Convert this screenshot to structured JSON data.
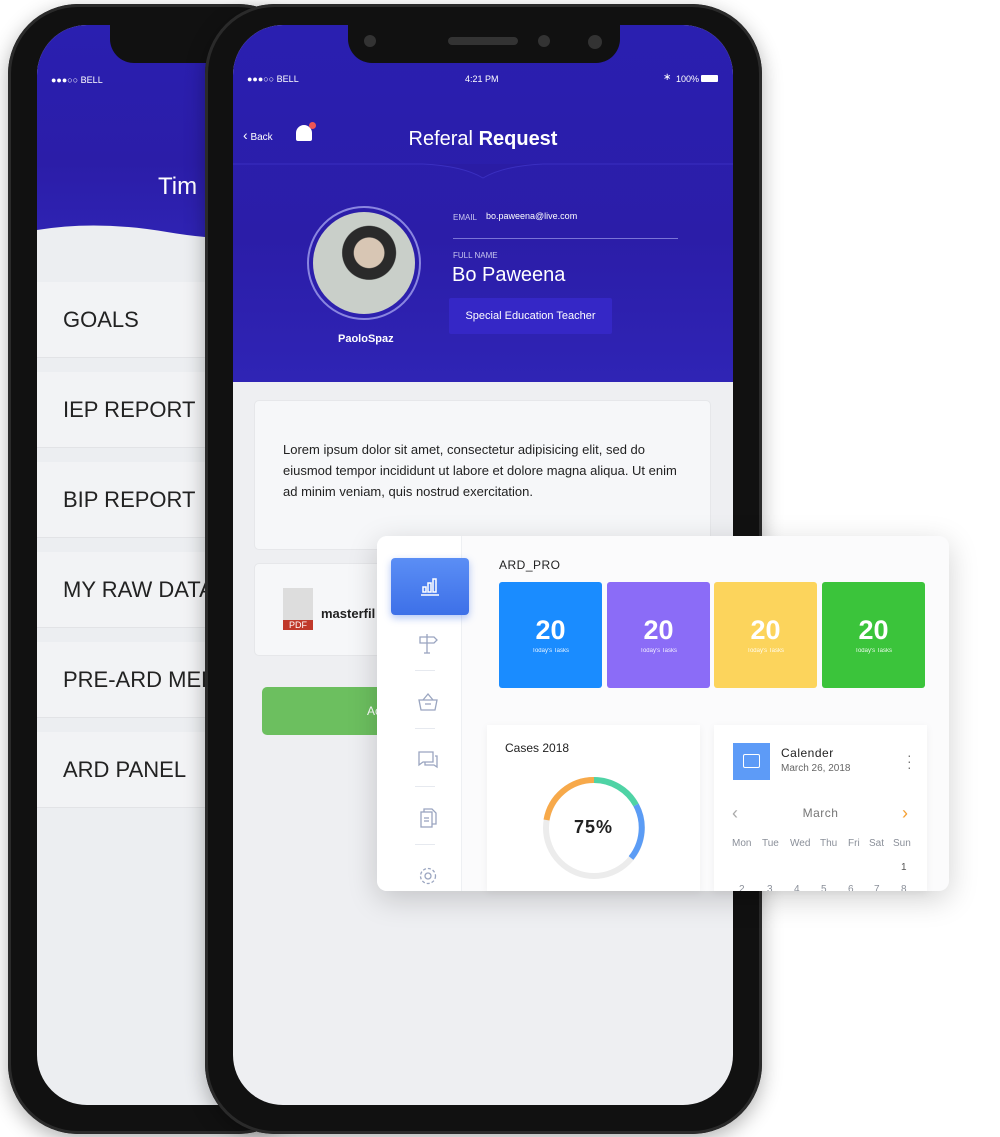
{
  "left_phone": {
    "status": {
      "carrier": "●●●○○ BELL"
    },
    "title": "Tim",
    "menu": [
      "GOALS",
      "IEP REPORT",
      "BIP REPORT",
      "MY RAW DATA",
      "PRE-ARD MEE",
      "ARD PANEL"
    ]
  },
  "main_phone": {
    "status": {
      "carrier": "●●●○○ BELL",
      "time": "4:21 PM",
      "battery": "100%"
    },
    "header": {
      "back": "Back",
      "title_light": "Referal",
      "title_bold": "Request"
    },
    "profile": {
      "username": "PaoloSpaz",
      "email_label": "EMAIL",
      "email": "bo.paweena@live.com",
      "name_label": "FULL NAME",
      "name": "Bo Paweena",
      "role": "Special Education Teacher"
    },
    "description": "Lorem ipsum dolor sit amet, consectetur adipisicing elit, sed do eiusmod tempor incididunt ut labore et dolore magna aliqua. Ut enim ad minim veniam, quis nostrud exercitation.",
    "attachment": {
      "icon_label": "PDF",
      "filename": "masterfil"
    },
    "button": "Ac"
  },
  "dashboard": {
    "title": "ARD_PRO",
    "tiles": [
      {
        "value": "20",
        "label": "Today's Tasks",
        "color": "#1a8cff"
      },
      {
        "value": "20",
        "label": "Today's Tasks",
        "color": "#8b6cf7"
      },
      {
        "value": "20",
        "label": "Today's Tasks",
        "color": "#fcd45c"
      },
      {
        "value": "20",
        "label": "Today's Tasks",
        "color": "#3bc43b"
      }
    ],
    "cases": {
      "title": "Cases 2018",
      "percent": "75%",
      "value": 75
    },
    "calendar": {
      "title": "Calender",
      "date": "March 26, 2018",
      "month": "March",
      "weekdays": [
        "Mon",
        "Tue",
        "Wed",
        "Thu",
        "Fri",
        "Sat",
        "Sun"
      ],
      "first_row": [
        "1"
      ],
      "second_row": [
        "2",
        "3",
        "4",
        "5",
        "6",
        "7",
        "8"
      ]
    },
    "sidebar_icons": [
      "bar-chart-icon",
      "signpost-icon",
      "basket-icon",
      "chat-icon",
      "document-icon",
      "gear-icon"
    ]
  }
}
